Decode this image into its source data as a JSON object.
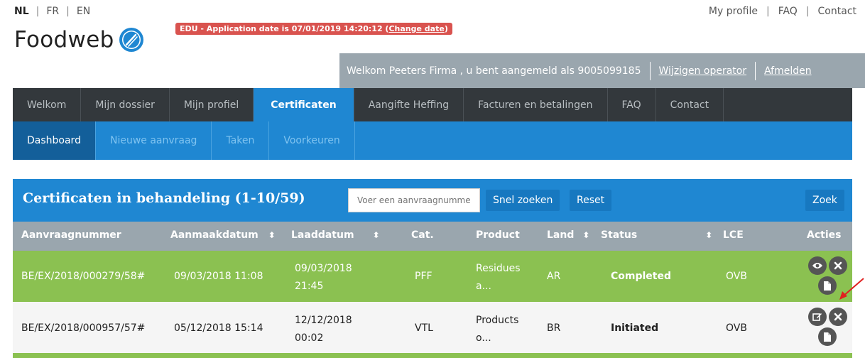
{
  "languages": {
    "nl": "NL",
    "fr": "FR",
    "en": "EN",
    "separator": "|"
  },
  "top_links": {
    "profile": "My profile",
    "faq": "FAQ",
    "contact": "Contact",
    "separator": "|"
  },
  "logo": {
    "text": "Foodweb",
    "icon": "fork-knife-icon"
  },
  "edu_banner": {
    "text": "EDU - Application date is 07/01/2019 14:20:12 (",
    "link": "Change date",
    "close": ")"
  },
  "welcome": {
    "message": "Welkom Peeters Firma , u bent aangemeld als 9005099185",
    "change_operator": "Wijzigen operator",
    "logout": "Afmelden"
  },
  "main_nav": [
    "Welkom",
    "Mijn dossier",
    "Mijn profiel",
    "Certificaten",
    "Aangifte Heffing",
    "Facturen en betalingen",
    "FAQ",
    "Contact"
  ],
  "sub_nav": [
    "Dashboard",
    "Nieuwe aanvraag",
    "Taken",
    "Voorkeuren"
  ],
  "panel": {
    "title": "Certificaten in behandeling (1-10/59)",
    "search_placeholder": "Voer een aanvraagnummer in",
    "quick_search": "Snel zoeken",
    "reset": "Reset",
    "search": "Zoek"
  },
  "table": {
    "columns": [
      "Aanvraagnummer",
      "Aanmaakdatum",
      "Laaddatum",
      "Cat.",
      "Product",
      "Land",
      "Status",
      "LCE",
      "Acties"
    ],
    "sort_icon": "⬍",
    "rows": [
      {
        "number": "BE/EX/2018/000279/58#",
        "created": "09/03/2018 11:08",
        "load_date": "09/03/2018",
        "load_time": "21:45",
        "cat": "PFF",
        "product_1": "Residues",
        "product_2": "a...",
        "country": "AR",
        "status": "Completed",
        "lce": "OVB",
        "actions": [
          "eye-icon",
          "close-icon",
          "document-icon"
        ]
      },
      {
        "number": "BE/EX/2018/000957/57#",
        "created": "05/12/2018 15:14",
        "load_date": "12/12/2018",
        "load_time": "00:02",
        "cat": "VTL",
        "product_1": "Products",
        "product_2": "o...",
        "country": "BR",
        "status": "Initiated",
        "lce": "OVB",
        "actions": [
          "edit-icon",
          "close-icon",
          "document-icon"
        ]
      }
    ]
  },
  "colors": {
    "accent": "#1f87d2",
    "completed_row": "#8bc151",
    "nav_dark": "#33383c",
    "banner_red": "#d9534f"
  }
}
